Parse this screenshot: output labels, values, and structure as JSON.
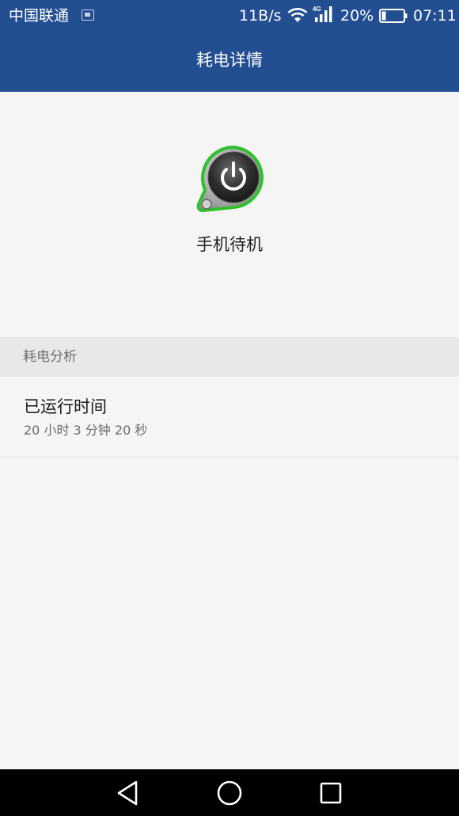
{
  "status_bar": {
    "carrier": "中国联通",
    "network_speed": "11B/s",
    "network_type": "4G",
    "battery_percent": "20%",
    "battery_level": 0.2,
    "time": "07:11"
  },
  "title_bar": {
    "title": "耗电详情"
  },
  "app_header": {
    "icon": "power-standby-icon",
    "name": "手机待机"
  },
  "section": {
    "label": "耗电分析"
  },
  "items": [
    {
      "title": "已运行时间",
      "value": "20 小时 3 分钟 20 秒"
    }
  ],
  "nav_bar": {
    "back": "back-triangle-icon",
    "home": "home-circle-icon",
    "recent": "recent-square-icon"
  },
  "colors": {
    "primary": "#234f92",
    "background": "#f5f5f5",
    "section_bg": "#e8e8e8",
    "icon_ring": "#2ec12e"
  }
}
